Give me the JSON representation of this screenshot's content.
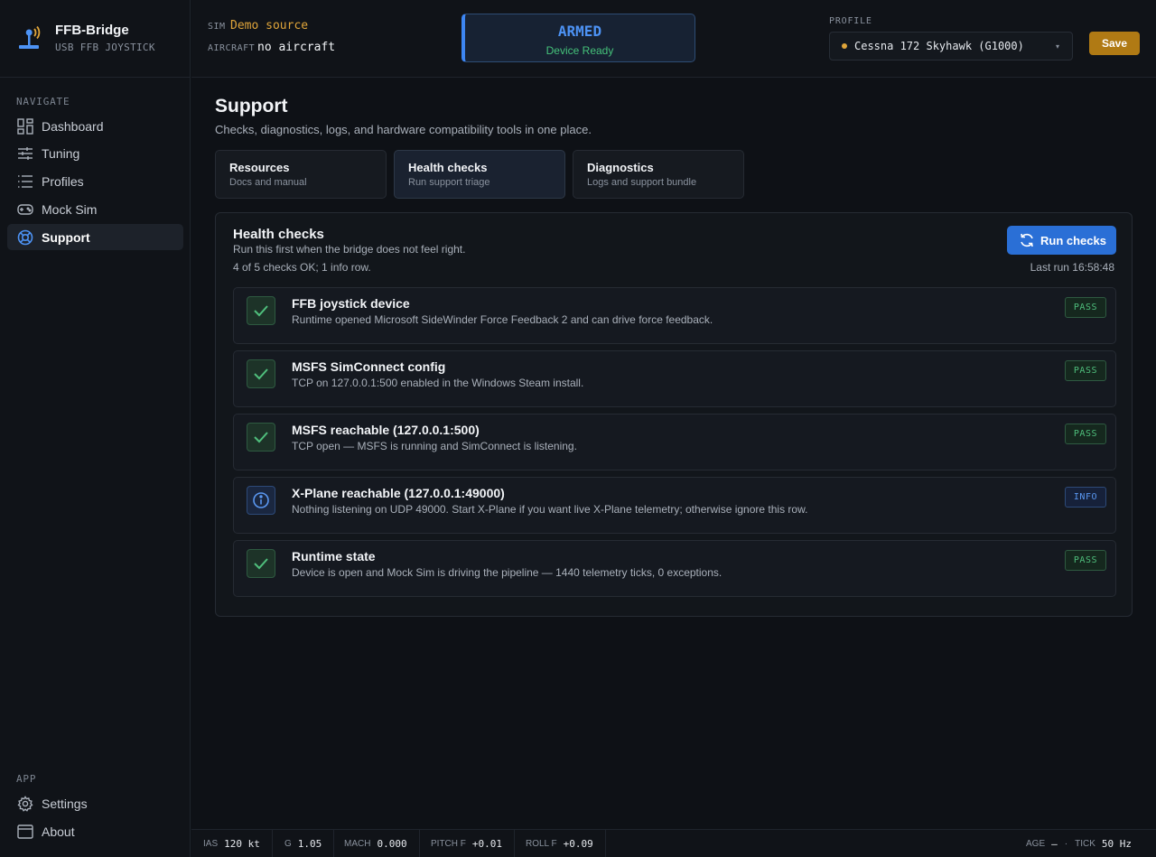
{
  "brand": {
    "title": "FFB-Bridge",
    "subtitle": "USB FFB JOYSTICK"
  },
  "sidebar": {
    "nav_heading": "NAVIGATE",
    "items": [
      {
        "label": "Dashboard",
        "icon": "dashboard-icon"
      },
      {
        "label": "Tuning",
        "icon": "sliders-icon"
      },
      {
        "label": "Profiles",
        "icon": "list-icon"
      },
      {
        "label": "Mock Sim",
        "icon": "gamepad-icon"
      },
      {
        "label": "Support",
        "icon": "lifebuoy-icon",
        "active": true
      }
    ],
    "app_heading": "APP",
    "app_items": [
      {
        "label": "Settings",
        "icon": "gear-icon"
      },
      {
        "label": "About",
        "icon": "window-icon"
      }
    ]
  },
  "topbar": {
    "sim_key": "SIM",
    "sim_value": "Demo source",
    "aircraft_key": "AIRCRAFT",
    "aircraft_value": "no aircraft",
    "armed_title": "ARMED",
    "armed_status": "Device Ready",
    "profile_key": "PROFILE",
    "profile_value": "Cessna 172 Skyhawk (G1000)",
    "save_label": "Save"
  },
  "page": {
    "title": "Support",
    "subtitle": "Checks, diagnostics, logs, and hardware compatibility tools in one place.",
    "tabs": [
      {
        "title": "Resources",
        "sub": "Docs and manual"
      },
      {
        "title": "Health checks",
        "sub": "Run support triage",
        "active": true
      },
      {
        "title": "Diagnostics",
        "sub": "Logs and support bundle"
      }
    ]
  },
  "health": {
    "title": "Health checks",
    "subtitle": "Run this first when the bridge does not feel right.",
    "summary": "4 of 5 checks OK; 1 info row.",
    "run_label": "Run checks",
    "last_run": "Last run 16:58:48",
    "checks": [
      {
        "title": "FFB joystick device",
        "desc": "Runtime opened Microsoft SideWinder Force Feedback 2 and can drive force feedback.",
        "status": "PASS"
      },
      {
        "title": "MSFS SimConnect config",
        "desc": "TCP on 127.0.0.1:500 enabled in the Windows Steam install.",
        "status": "PASS"
      },
      {
        "title": "MSFS reachable (127.0.0.1:500)",
        "desc": "TCP open — MSFS is running and SimConnect is listening.",
        "status": "PASS"
      },
      {
        "title": "X-Plane reachable (127.0.0.1:49000)",
        "desc": "Nothing listening on UDP 49000. Start X-Plane if you want live X-Plane telemetry; otherwise ignore this row.",
        "status": "INFO"
      },
      {
        "title": "Runtime state",
        "desc": "Device is open and Mock Sim is driving the pipeline — 1440 telemetry ticks, 0 exceptions.",
        "status": "PASS"
      }
    ]
  },
  "statusbar": {
    "ias_key": "IAS",
    "ias_val": "120 kt",
    "g_key": "G",
    "g_val": "1.05",
    "mach_key": "MACH",
    "mach_val": "0.000",
    "pitch_key": "PITCH F",
    "pitch_val": "+0.01",
    "roll_key": "ROLL F",
    "roll_val": "+0.09",
    "age_key": "AGE",
    "age_val": "—",
    "sep": "·",
    "tick_key": "TICK",
    "tick_val": "50 Hz"
  },
  "colors": {
    "accent": "#2a6fd6",
    "pass": "#4fbf7c",
    "info": "#5a98f2",
    "warn": "#e0a53a",
    "save": "#b07a14"
  }
}
